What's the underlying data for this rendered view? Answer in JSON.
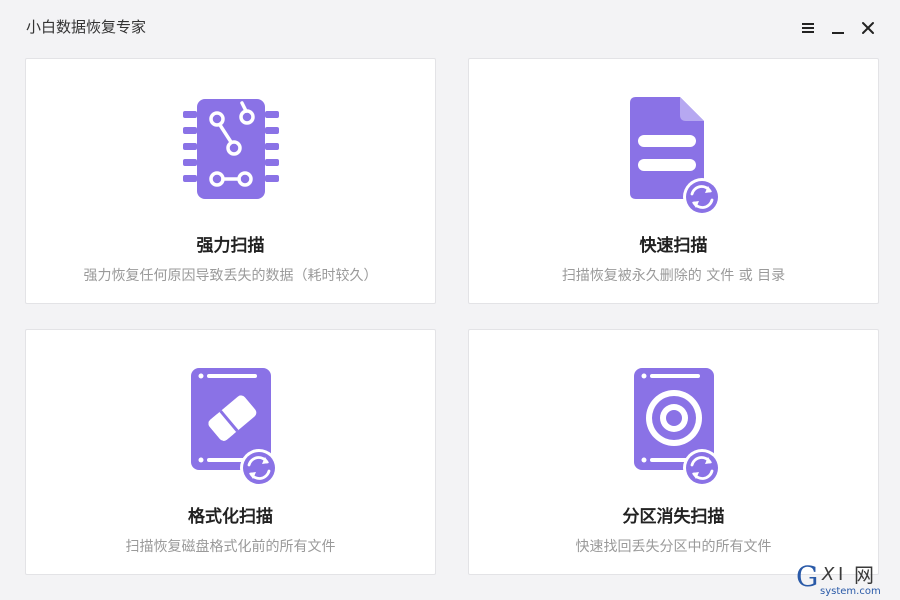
{
  "window": {
    "title": "小白数据恢复专家",
    "controls": {
      "menu_icon": "hamburger-menu-icon",
      "minimize_icon": "minimize-icon",
      "close_icon": "close-icon"
    }
  },
  "colors": {
    "accent": "#8a72e6",
    "card_bg": "#ffffff",
    "page_bg": "#f3f3f5"
  },
  "cards": [
    {
      "title": "强力扫描",
      "desc": "强力恢复任何原因导致丢失的数据（耗时较久）",
      "icon": "chip-icon"
    },
    {
      "title": "快速扫描",
      "desc": "扫描恢复被永久删除的 文件 或 目录",
      "icon": "document-refresh-icon"
    },
    {
      "title": "格式化扫描",
      "desc": "扫描恢复磁盘格式化前的所有文件",
      "icon": "disk-eraser-icon"
    },
    {
      "title": "分区消失扫描",
      "desc": "快速找回丢失分区中的所有文件",
      "icon": "disk-partition-icon"
    }
  ],
  "watermark": {
    "text": "G X I 网",
    "subtext": "system.com"
  }
}
